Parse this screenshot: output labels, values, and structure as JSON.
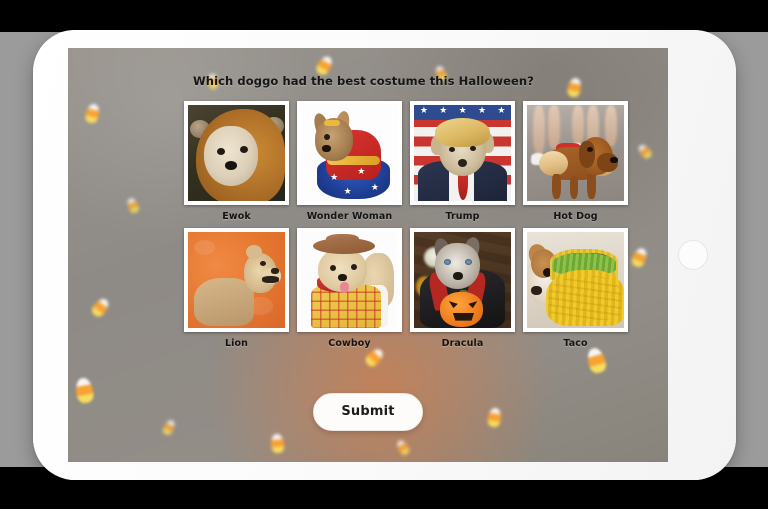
{
  "device": {
    "type": "tablet",
    "home_button": "home-button"
  },
  "poll": {
    "question": "Which doggo had the best costume this Halloween?",
    "options": [
      {
        "label": "Ewok",
        "image_alt": "Shih tzu dog wearing a brown Ewok hood costume"
      },
      {
        "label": "Wonder Woman",
        "image_alt": "Terrier dog in a Wonder Woman costume with red top and blue star skirt"
      },
      {
        "label": "Trump",
        "image_alt": "Dog wearing a blonde wig, navy suit and red tie in front of an American flag"
      },
      {
        "label": "Hot Dog",
        "image_alt": "Dachshund wearing a hot dog bun costume on a street"
      },
      {
        "label": "Lion",
        "image_alt": "Golden retriever wearing a lion mane on an orange background"
      },
      {
        "label": "Cowboy",
        "image_alt": "Poodle dressed as a cowboy with hat, red bandana and yellow plaid shirt"
      },
      {
        "label": "Dracula",
        "image_alt": "Husky in a black Dracula cape with a jack-o-lantern"
      },
      {
        "label": "Taco",
        "image_alt": "Chihuahua wearing a crocheted taco costume"
      }
    ],
    "submit_label": "Submit"
  },
  "colors": {
    "backdrop": "#9b9b9b",
    "letterbox": "#000000",
    "device_body": "#fdfdfd",
    "text": "#161616",
    "candy_corn_orange": "#ffa52e",
    "candy_corn_yellow": "#ffe45c",
    "submit_background": "#fdfcfb"
  }
}
